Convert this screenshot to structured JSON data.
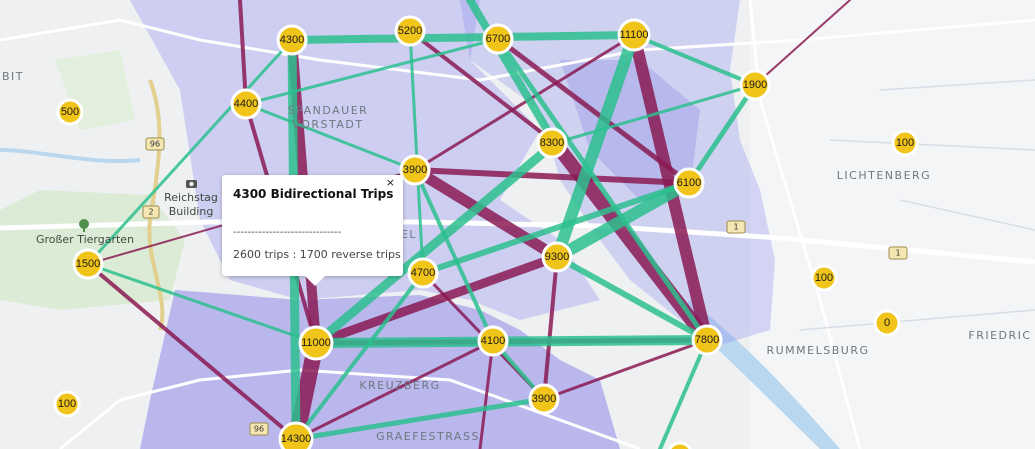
{
  "map": {
    "colors": {
      "link_forward": "#2bbf8e",
      "link_reverse": "#8a1a53",
      "marker": "#f0c419",
      "district": "#8f8ff0"
    },
    "places": [
      "BIT",
      "SPANDAUER",
      "VORSTADT",
      "LICHTENBERG",
      "RUMMELSBURG",
      "FRIEDRIC",
      "KREUZBERG",
      "GRAEFESTRASS",
      "EL"
    ],
    "landmarks": [
      "Reichstag",
      "Building",
      "Großer Tiergarten"
    ],
    "road_shields": [
      "96",
      "2",
      "1",
      "1",
      "96"
    ],
    "landmark_icons": [
      "camera-icon",
      "tree-icon"
    ],
    "stations": [
      {
        "id": "n4300",
        "label": "4300"
      },
      {
        "id": "n5200",
        "label": "5200"
      },
      {
        "id": "n6700",
        "label": "6700"
      },
      {
        "id": "n11100",
        "label": "11100"
      },
      {
        "id": "n1900",
        "label": "1900"
      },
      {
        "id": "n4400",
        "label": "4400"
      },
      {
        "id": "n8300",
        "label": "8300"
      },
      {
        "id": "n3900a",
        "label": "3900"
      },
      {
        "id": "n6100",
        "label": "6100"
      },
      {
        "id": "n1500",
        "label": "1500"
      },
      {
        "id": "n4700",
        "label": "4700"
      },
      {
        "id": "n9300",
        "label": "9300"
      },
      {
        "id": "n11000",
        "label": "11000"
      },
      {
        "id": "n4100",
        "label": "4100"
      },
      {
        "id": "n7800",
        "label": "7800"
      },
      {
        "id": "n3900b",
        "label": "3900"
      },
      {
        "id": "n14300",
        "label": "14300"
      }
    ],
    "clusters": [
      {
        "id": "c500",
        "label": "500"
      },
      {
        "id": "c100a",
        "label": "100"
      },
      {
        "id": "c100b",
        "label": "100"
      },
      {
        "id": "c0",
        "label": "0"
      },
      {
        "id": "c100c",
        "label": "100"
      }
    ]
  },
  "popup": {
    "title": "4300 Bidirectional Trips",
    "separator": "------------------------------",
    "body": "2600 trips : 1700 reverse trips",
    "close": "×"
  }
}
